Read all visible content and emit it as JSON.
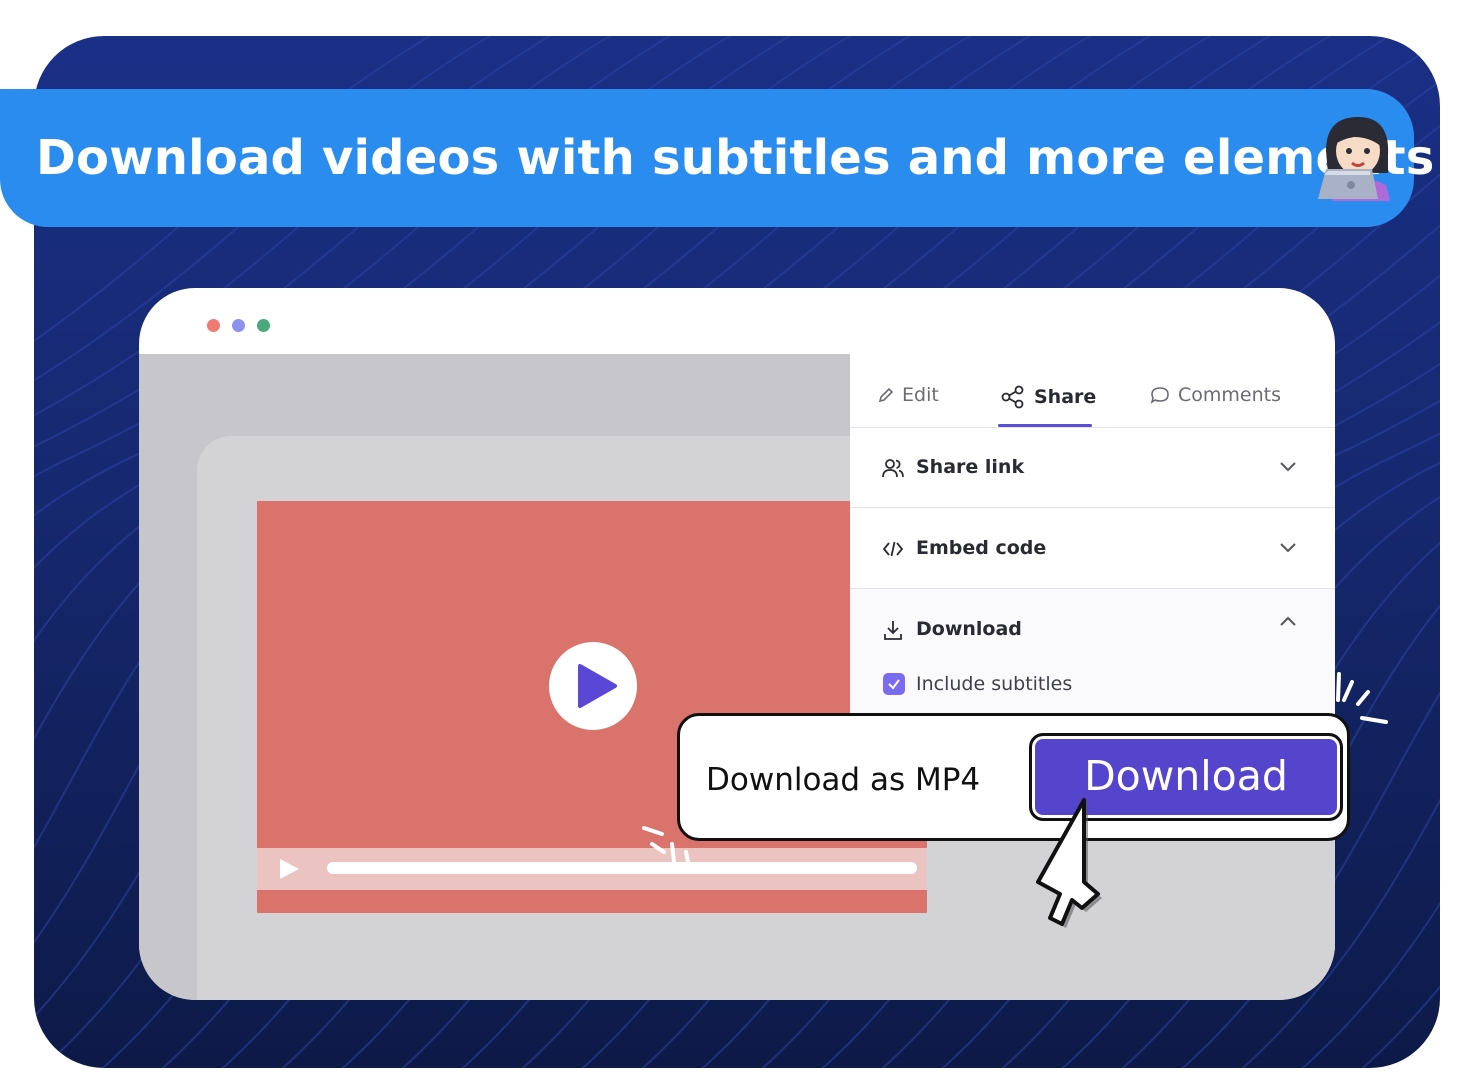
{
  "banner": {
    "title": "Download videos with subtitles and more elements",
    "icon": "woman-technologist-emoji-icon"
  },
  "window": {
    "dots": [
      "#f07b73",
      "#8e92ee",
      "#4aa97c"
    ]
  },
  "panel": {
    "tabs": [
      {
        "label": "Edit",
        "icon": "pencil-icon",
        "active": false
      },
      {
        "label": "Share",
        "icon": "share-nodes-icon",
        "active": true
      },
      {
        "label": "Comments",
        "icon": "speech-bubble-icon",
        "active": false
      }
    ],
    "sections": [
      {
        "label": "Share link",
        "icon": "users-icon",
        "expanded": false
      },
      {
        "label": "Embed code",
        "icon": "code-icon",
        "expanded": false
      },
      {
        "label": "Download",
        "icon": "download-icon",
        "expanded": true
      }
    ],
    "include_subtitles": {
      "label": "Include subtitles",
      "checked": true
    }
  },
  "download_popup": {
    "format_label": "Download as MP4",
    "button_label": "Download"
  },
  "colors": {
    "banner": "#2b8cf0",
    "accent": "#5544cc",
    "video": "#d9736c",
    "background": "#16286f"
  }
}
